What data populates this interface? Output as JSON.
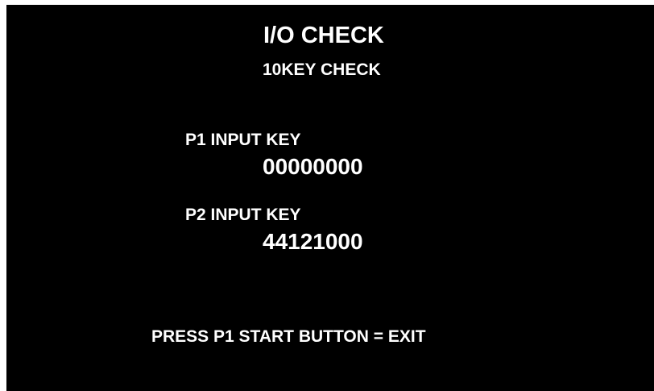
{
  "screen": {
    "title": "I/O CHECK",
    "subtitle": "10KEY CHECK",
    "p1": {
      "label": "P1 INPUT KEY",
      "value": "00000000"
    },
    "p2": {
      "label": "P2 INPUT KEY",
      "value": "44121000"
    },
    "exit_message": "PRESS P1 START BUTTON = EXIT"
  },
  "colors": {
    "background": "#000000",
    "text": "#ffffff"
  }
}
